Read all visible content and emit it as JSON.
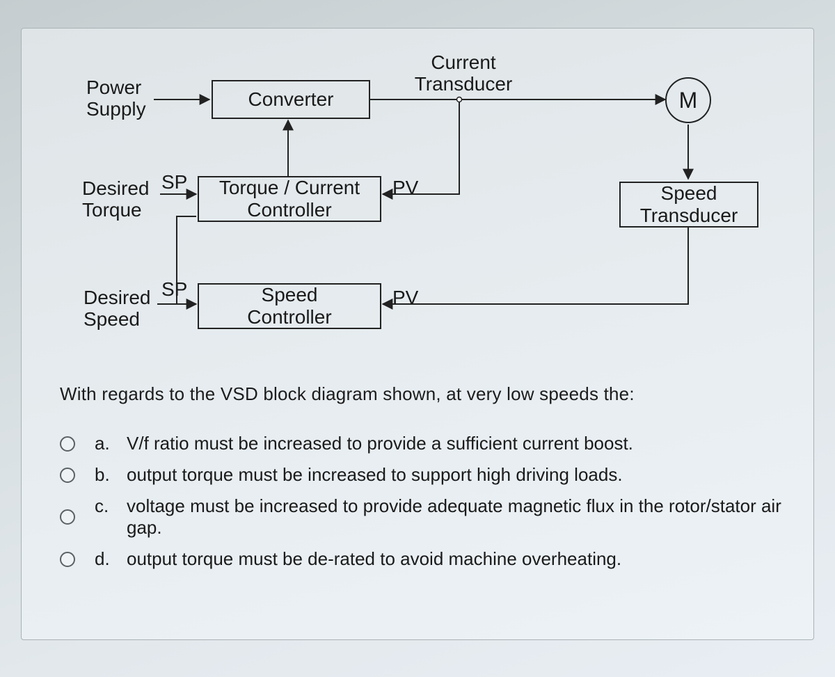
{
  "diagram": {
    "labels": {
      "powerSupply": "Power\nSupply",
      "converter": "Converter",
      "currentTransducer": "Current\nTransducer",
      "motor": "M",
      "desiredTorque": "Desired\nTorque",
      "sp1": "SP",
      "torqueController": "Torque / Current\nController",
      "pv1": "PV",
      "speedTransducer": "Speed\nTransducer",
      "desiredSpeed": "Desired\nSpeed",
      "sp2": "SP",
      "speedController": "Speed\nController",
      "pv2": "PV"
    }
  },
  "questionText": "With regards to the VSD block diagram shown, at very low speeds the:",
  "options": [
    {
      "letter": "a.",
      "text": "V/f ratio must be increased to provide a sufficient current boost."
    },
    {
      "letter": "b.",
      "text": "output torque must be increased to support high driving loads."
    },
    {
      "letter": "c.",
      "text": "voltage must be increased to provide adequate magnetic flux in the rotor/stator air gap."
    },
    {
      "letter": "d.",
      "text": "output torque must be de-rated to avoid machine overheating."
    }
  ]
}
